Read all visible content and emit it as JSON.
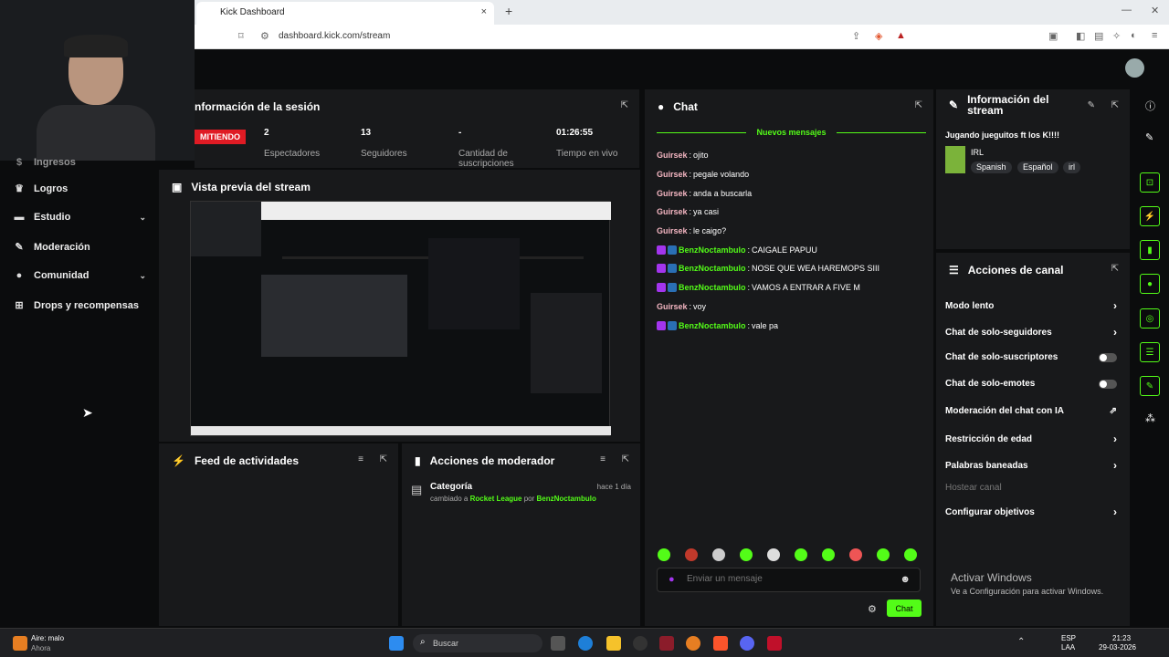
{
  "browser": {
    "tab_title": "Kick Dashboard",
    "close": "×",
    "newtab": "+",
    "url": "dashboard.kick.com/stream",
    "min": "—",
    "max": "☐",
    "close_win": "✕"
  },
  "sidebar": {
    "items": [
      {
        "label": "Logros"
      },
      {
        "label": "Estudio"
      },
      {
        "label": "Moderación"
      },
      {
        "label": "Comunidad"
      },
      {
        "label": "Drops y recompensas"
      }
    ],
    "partial_label": "Ingresos"
  },
  "session": {
    "title": "nformación de la sesión",
    "live": "MITIENDO",
    "stats": [
      {
        "value": "2",
        "label": "Espectadores"
      },
      {
        "value": "13",
        "label": "Seguidores"
      },
      {
        "value": "-",
        "label": "Cantidad de suscripciones"
      },
      {
        "value": "01:26:55",
        "label": "Tiempo en vivo"
      }
    ]
  },
  "preview": {
    "title": "Vista previa del stream"
  },
  "feed": {
    "title": "Feed de actividades"
  },
  "modactions": {
    "title": "Acciones de moderador",
    "item_title": "Categoría",
    "item_time": "hace 1 día",
    "item_pre": "cambiado a",
    "item_cat": "Rocket League",
    "item_by": "por",
    "item_user": "BenzNoctambulo"
  },
  "chat": {
    "title": "Chat",
    "new_messages": "Nuevos mensajes",
    "messages": [
      {
        "user": "Guirsek",
        "text": "ojito",
        "badges": false
      },
      {
        "user": "Guirsek",
        "text": "pegale volando",
        "badges": false
      },
      {
        "user": "Guirsek",
        "text": "anda a buscarla",
        "badges": false
      },
      {
        "user": "Guirsek",
        "text": "ya casi",
        "badges": false
      },
      {
        "user": "Guirsek",
        "text": "le caigo?",
        "badges": false
      },
      {
        "user": "BenzNoctambulo",
        "text": "CAIGALE PAPUU",
        "badges": true
      },
      {
        "user": "BenzNoctambulo",
        "text": "NOSE QUE WEA HAREMOPS SIII",
        "badges": true
      },
      {
        "user": "BenzNoctambulo",
        "text": "VAMOS A ENTRAR A FIVE M",
        "badges": true
      },
      {
        "user": "Guirsek",
        "text": "voy",
        "badges": false
      },
      {
        "user": "BenzNoctambulo",
        "text": "vale pa",
        "badges": true
      }
    ],
    "placeholder": "Enviar un mensaje",
    "send": "Chat"
  },
  "streaminfo": {
    "title": "Información del stream",
    "stream_title": "Jugando jueguitos ft los K!!!!",
    "category": "IRL",
    "tags": [
      "Spanish",
      "Español",
      "irl"
    ]
  },
  "channel": {
    "title": "Acciones de canal",
    "items": [
      {
        "label": "Modo lento",
        "ctrl": "arrow"
      },
      {
        "label": "Chat de solo-seguidores",
        "ctrl": "arrow"
      },
      {
        "label": "Chat de solo-suscriptores",
        "ctrl": "toggle"
      },
      {
        "label": "Chat de solo-emotes",
        "ctrl": "toggle"
      },
      {
        "label": "Moderación del chat con IA",
        "ctrl": "ext"
      },
      {
        "label": "Restricción de edad",
        "ctrl": "arrow"
      },
      {
        "label": "Palabras baneadas",
        "ctrl": "arrow"
      },
      {
        "label": "Hostear canal",
        "ctrl": "none"
      },
      {
        "label": "Configurar objetivos",
        "ctrl": "arrow"
      }
    ]
  },
  "windows": {
    "activate_title": "Activar Windows",
    "activate_sub": "Ve a Configuración para activar Windows."
  },
  "taskbar": {
    "weather": "Aire: malo",
    "weather_sub": "Ahora",
    "search": "Buscar",
    "lang": "ESP",
    "lang_sub": "LAA",
    "time": "21:23",
    "date": "29-03-2026"
  },
  "colors": {
    "accent": "#53fc18",
    "panel": "#18191b",
    "bg": "#0b0c0d",
    "live": "#e01b24"
  }
}
